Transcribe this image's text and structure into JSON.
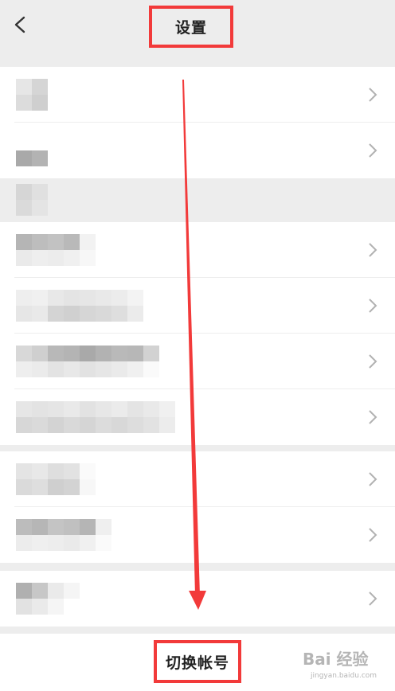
{
  "header": {
    "title": "设置",
    "back_icon": "chevron-left-icon"
  },
  "bottom": {
    "switch_account_label": "切换帐号"
  },
  "watermark": {
    "text": "Bai 经验",
    "url_text": "jingyan.baidu.com"
  },
  "colors": {
    "annotation_red": "#f23a3a",
    "background": "#ededed",
    "row_background": "#ffffff"
  },
  "icons": {
    "row_chevron": "chevron-right-icon"
  }
}
